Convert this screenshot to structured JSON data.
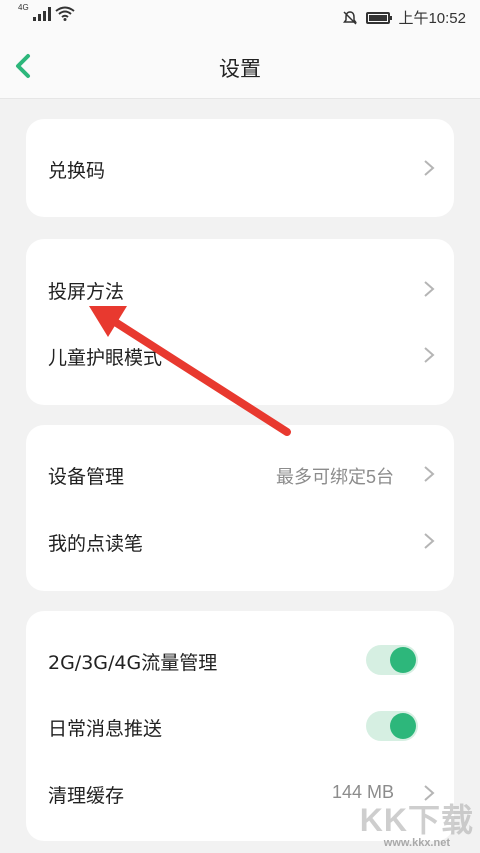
{
  "status_bar": {
    "network": "4G",
    "time": "上午10:52",
    "icons": [
      "signal-icon",
      "wifi-icon",
      "bell-off-icon",
      "battery-icon"
    ]
  },
  "header": {
    "title": "设置",
    "back_icon": "chevron-left-icon"
  },
  "colors": {
    "accent": "#2db77b",
    "toggle_track": "#d6efe2",
    "arrow": "#e8392f"
  },
  "sections": [
    {
      "items": [
        {
          "label": "兑换码"
        }
      ]
    },
    {
      "items": [
        {
          "label": "投屏方法"
        },
        {
          "label": "儿童护眼模式"
        }
      ]
    },
    {
      "items": [
        {
          "label": "设备管理",
          "value": "最多可绑定5台"
        },
        {
          "label": "我的点读笔"
        }
      ]
    },
    {
      "items": [
        {
          "label": "2G/3G/4G流量管理",
          "toggle": true
        },
        {
          "label": "日常消息推送",
          "toggle": true
        },
        {
          "label": "清理缓存",
          "value": "144 MB"
        }
      ]
    }
  ],
  "watermark": {
    "text": "KK下载",
    "url": "www.kkx.net"
  }
}
